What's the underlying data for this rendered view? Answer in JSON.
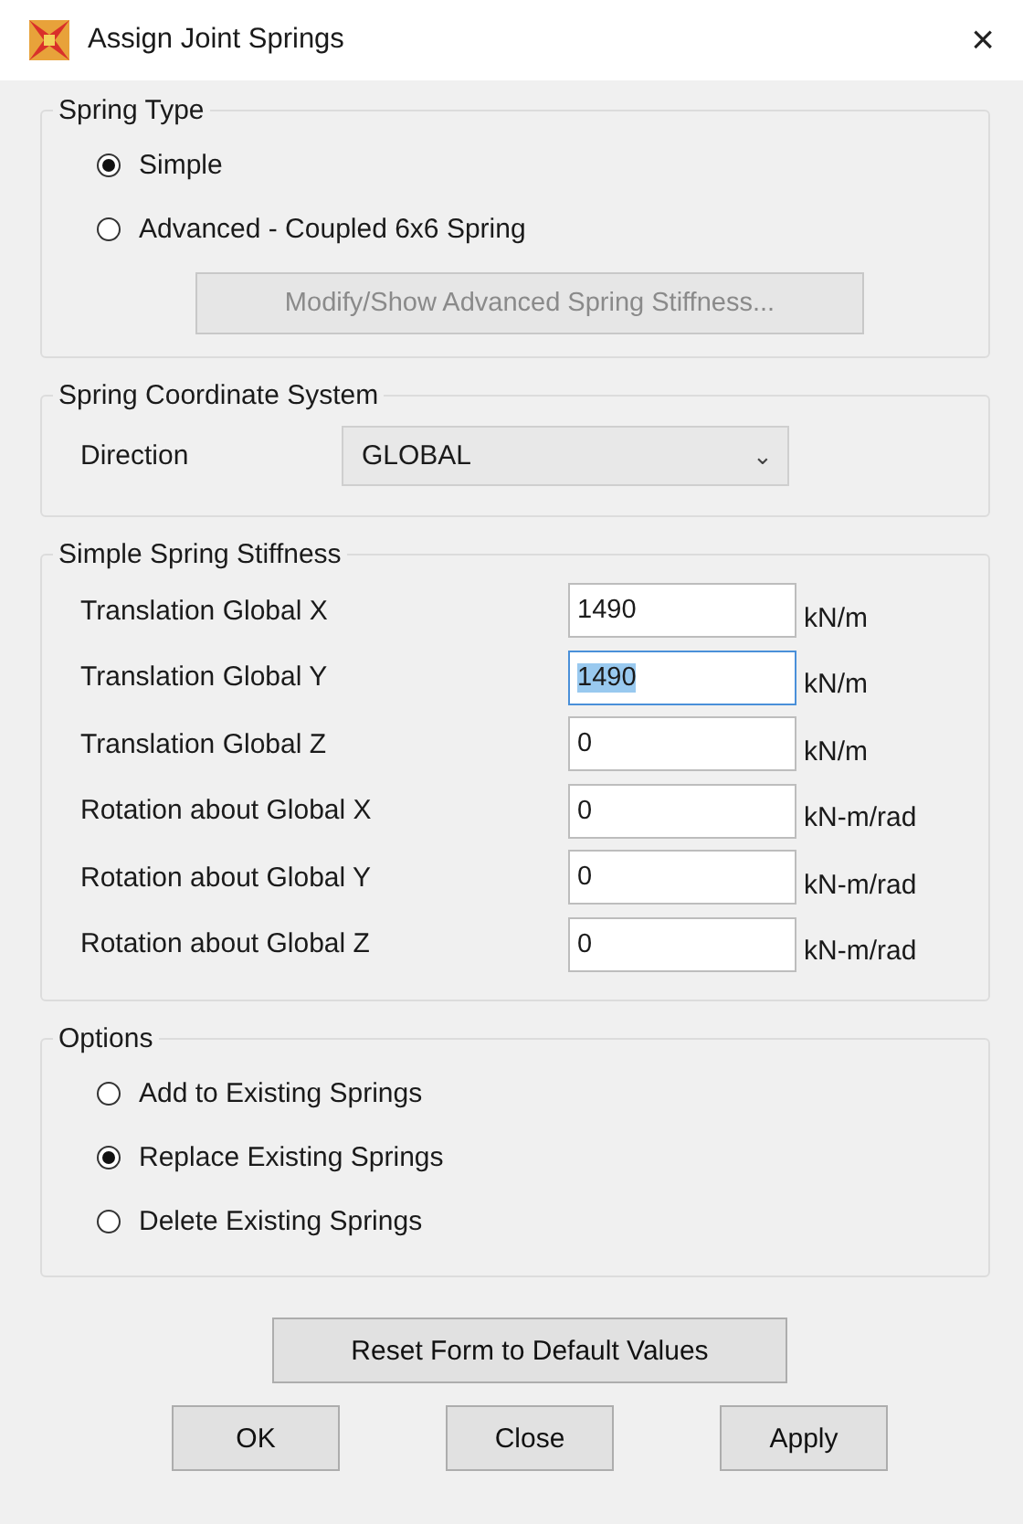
{
  "window": {
    "title": "Assign Joint Springs",
    "close": "×"
  },
  "spring_type": {
    "title": "Spring Type",
    "options": [
      {
        "label": "Simple",
        "selected": true
      },
      {
        "label": "Advanced - Coupled 6x6 Spring",
        "selected": false
      }
    ],
    "button": {
      "label": "Modify/Show Advanced Spring Stiffness...",
      "disabled": true
    }
  },
  "coordinate_system": {
    "title": "Spring Coordinate System",
    "label": "Direction",
    "value": "GLOBAL",
    "caret": "⌄"
  },
  "stiffness": {
    "title": "Simple Spring Stiffness",
    "rows": [
      {
        "label": "Translation Global X",
        "value": "1490",
        "unit": "kN/m",
        "focused": false
      },
      {
        "label": "Translation Global Y",
        "value": "1490",
        "unit": "kN/m",
        "focused": true
      },
      {
        "label": "Translation Global Z",
        "value": "0",
        "unit": "kN/m",
        "focused": false
      },
      {
        "label": "Rotation about Global X",
        "value": "0",
        "unit": "kN-m/rad",
        "focused": false
      },
      {
        "label": "Rotation about Global Y",
        "value": "0",
        "unit": "kN-m/rad",
        "focused": false
      },
      {
        "label": "Rotation about Global Z",
        "value": "0",
        "unit": "kN-m/rad",
        "focused": false
      }
    ]
  },
  "options": {
    "title": "Options",
    "items": [
      {
        "label": "Add to Existing Springs",
        "selected": false
      },
      {
        "label": "Replace Existing Springs",
        "selected": true
      },
      {
        "label": "Delete Existing Springs",
        "selected": false
      }
    ]
  },
  "reset_button": "Reset Form to Default Values",
  "buttons": [
    "OK",
    "Close",
    "Apply"
  ]
}
